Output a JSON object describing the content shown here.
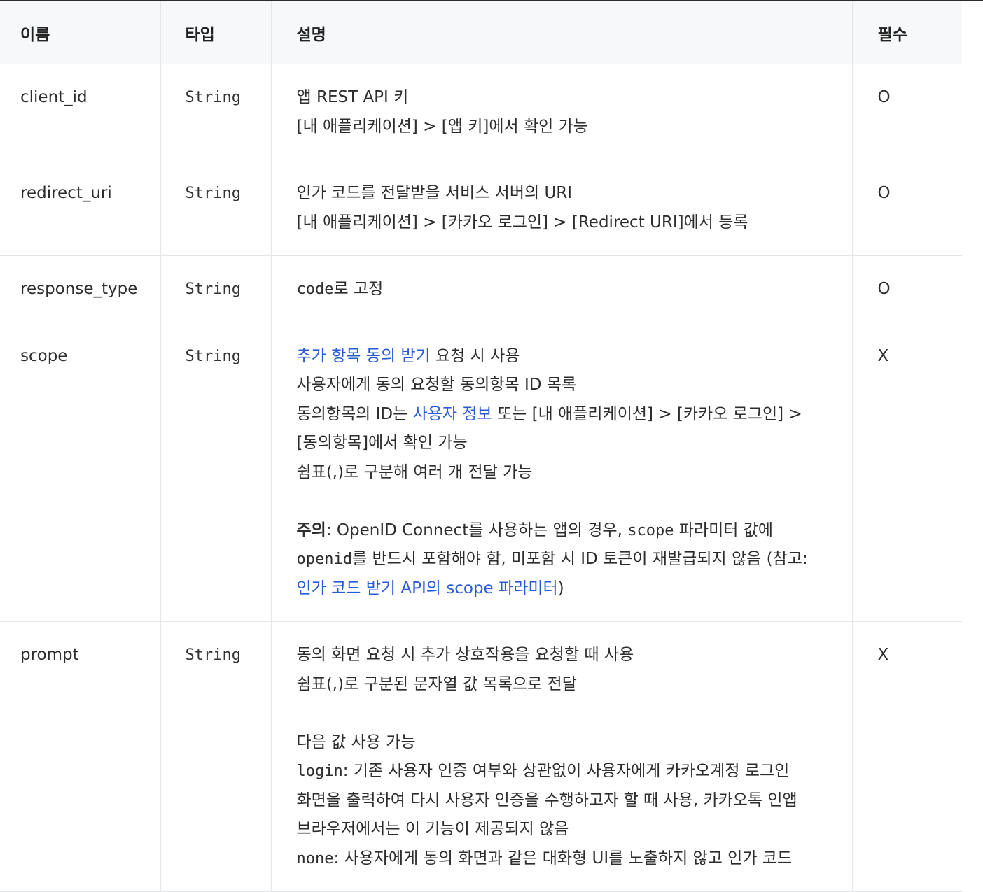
{
  "columns": {
    "name": "이름",
    "type": "타입",
    "description": "설명",
    "required": "필수"
  },
  "rows": [
    {
      "name": "client_id",
      "type": "String",
      "required": "O",
      "desc": {
        "l1": "앱 REST API 키",
        "l2": "[내 애플리케이션] > [앱 키]에서 확인 가능"
      }
    },
    {
      "name": "redirect_uri",
      "type": "String",
      "required": "O",
      "desc": {
        "l1": "인가 코드를 전달받을 서비스 서버의 URI",
        "l2": "[내 애플리케이션] > [카카오 로그인] > [Redirect URI]에서 등록"
      }
    },
    {
      "name": "response_type",
      "type": "String",
      "required": "O",
      "desc": {
        "code": "code",
        "rest": "로 고정"
      }
    },
    {
      "name": "scope",
      "type": "String",
      "required": "X",
      "desc": {
        "l1_link": "추가 항목 동의 받기",
        "l1_rest": " 요청 시 사용",
        "l2": "사용자에게 동의 요청할 동의항목 ID 목록",
        "l3_pre": "동의항목의 ID는 ",
        "l3_link": "사용자 정보",
        "l3_post": " 또는 [내 애플리케이션] > [카카오 로그인] >",
        "l4": "[동의항목]에서 확인 가능",
        "l5": "쉼표(,)로 구분해 여러 개 전달 가능",
        "note_label": "주의",
        "note_1": ": OpenID Connect를 사용하는 앱의 경우, ",
        "note_code1": "scope",
        "note_2": " 파라미터 값에",
        "note_code2": "openid",
        "note_3": "를 반드시 포함해야 함, 미포함 시 ID 토큰이 재발급되지 않음 (참고:",
        "note_link": "인가 코드 받기 API의 scope 파라미터",
        "note_end": ")"
      }
    },
    {
      "name": "prompt",
      "type": "String",
      "required": "X",
      "desc": {
        "l1": "동의 화면 요청 시 추가 상호작용을 요청할 때 사용",
        "l2": "쉼표(,)로 구분된 문자열 값 목록으로 전달",
        "l3": "다음 값 사용 가능",
        "login_code": "login",
        "login_1": ": 기존 사용자 인증 여부와 상관없이 사용자에게 카카오계정 로그인",
        "login_2": "화면을 출력하여 다시 사용자 인증을 수행하고자 할 때 사용, 카카오톡 인앱",
        "login_3": "브라우저에서는 이 기능이 제공되지 않음",
        "none_code": "none",
        "none_1": ": 사용자에게 동의 화면과 같은 대화형 UI를 노출하지 않고 인가 코드"
      }
    }
  ]
}
